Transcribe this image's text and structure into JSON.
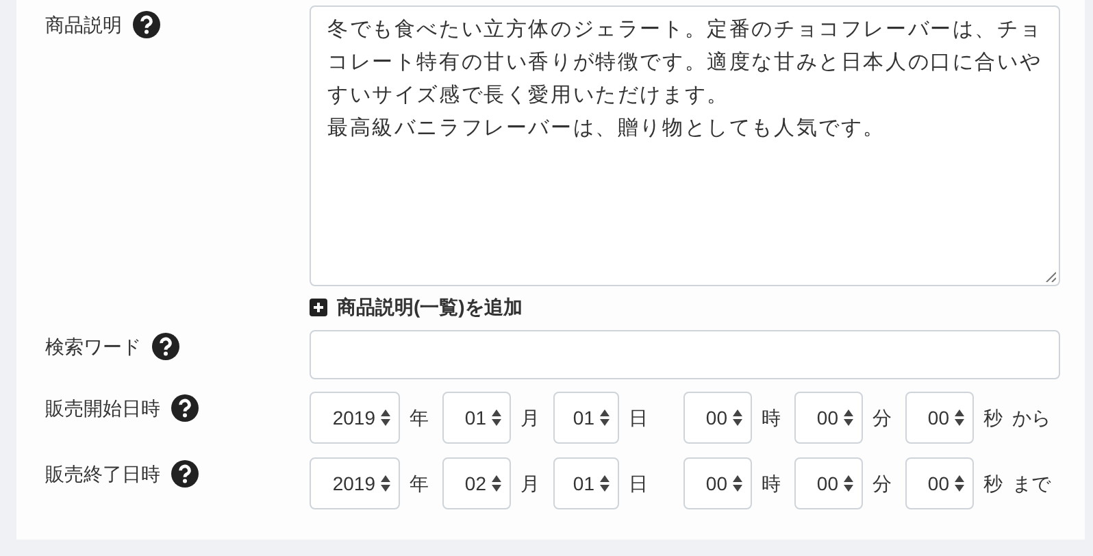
{
  "description": {
    "label": "商品説明",
    "paragraphs": [
      "冬でも食べたい立方体のジェラート。定番のチョコフレーバーは、チョコレート特有の甘い香りが特徴です。適度な甘みと日本人の口に合いやすいサイズ感で長く愛用いただけます。",
      "最高級バニラフレーバーは、贈り物としても人気です。"
    ],
    "add_link": "商品説明(一覧)を追加"
  },
  "search_words": {
    "label": "検索ワード"
  },
  "dates": [
    {
      "label": "販売開始日時",
      "parts": [
        {
          "value": "2019",
          "unit": "年"
        },
        {
          "value": "01",
          "unit": "月"
        },
        {
          "value": "01",
          "unit": "日"
        },
        {
          "value": "00",
          "unit": "時"
        },
        {
          "value": "00",
          "unit": "分"
        },
        {
          "value": "00",
          "unit": "秒"
        }
      ],
      "suffix": "から"
    },
    {
      "label": "販売終了日時",
      "parts": [
        {
          "value": "2019",
          "unit": "年"
        },
        {
          "value": "02",
          "unit": "月"
        },
        {
          "value": "01",
          "unit": "日"
        },
        {
          "value": "00",
          "unit": "時"
        },
        {
          "value": "00",
          "unit": "分"
        },
        {
          "value": "00",
          "unit": "秒"
        }
      ],
      "suffix": "まで"
    }
  ]
}
